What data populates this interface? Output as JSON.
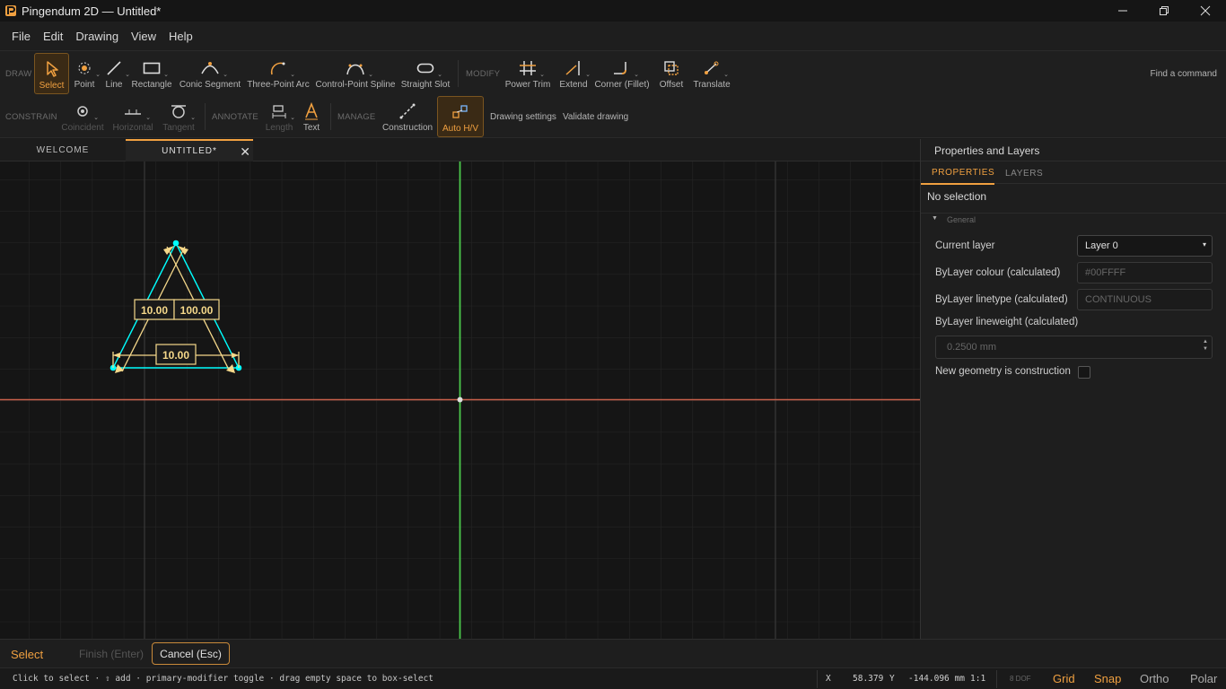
{
  "window": {
    "title": "Pingendum 2D — Untitled*",
    "controls": [
      "minimize-icon",
      "maximize-icon",
      "close-icon"
    ]
  },
  "menu": [
    "File",
    "Edit",
    "Drawing",
    "View",
    "Help"
  ],
  "toolbar": {
    "draw_label": "DRAW",
    "modify_label": "MODIFY",
    "draw_tools": {
      "select": "Select",
      "point": "Point",
      "line": "Line",
      "rectangle": "Rectangle",
      "conic": "Conic Segment",
      "arc": "Three-Point Arc",
      "spline": "Control-Point Spline",
      "slot": "Straight Slot"
    },
    "modify_tools": {
      "power_trim": "Power Trim",
      "extend": "Extend",
      "fillet": "Corner (Fillet)",
      "offset": "Offset",
      "translate": "Translate"
    },
    "find_command": "Find a command"
  },
  "toolbar2": {
    "constrain_label": "CONSTRAIN",
    "annotate_label": "ANNOTATE",
    "manage_label": "MANAGE",
    "coincident": "Coincident",
    "horizontal": "Horizontal",
    "tangent": "Tangent",
    "length": "Length",
    "text": "Text",
    "construction": "Construction",
    "auto_hv": "Auto H/V",
    "drawing_settings": "Drawing settings",
    "validate_drawing": "Validate drawing"
  },
  "tabs": {
    "welcome": "WELCOME",
    "untitled": "UNTITLED*"
  },
  "canvas": {
    "dim_left": "10.00",
    "dim_angle": "100.00",
    "dim_bottom": "10.00",
    "geometry_color": "#00FFFF",
    "constraint_color": "#F5D88A"
  },
  "panel": {
    "title": "Properties and Layers",
    "tab_properties": "PROPERTIES",
    "tab_layers": "LAYERS",
    "no_selection": "No selection",
    "section_general": "General",
    "current_layer_label": "Current layer",
    "current_layer_value": "Layer 0",
    "bylayer_colour_label": "ByLayer colour (calculated)",
    "bylayer_colour_value": "#00FFFF",
    "bylayer_linetype_label": "ByLayer linetype (calculated)",
    "bylayer_linetype_value": "CONTINUOUS",
    "bylayer_lineweight_label": "ByLayer lineweight (calculated)",
    "bylayer_lineweight_value": "0.2500 mm",
    "construction_label": "New geometry is construction",
    "construction_checked": false
  },
  "command_bar": {
    "mode": "Select",
    "finish": "Finish (Enter)",
    "cancel": "Cancel (Esc)"
  },
  "status": {
    "hint": "Click to select · ⇧ add · primary-modifier toggle · drag empty space to box-select",
    "x_label": "X",
    "x_value": "58.379",
    "y_label": "Y",
    "y_value": "-144.096 mm",
    "scale": "1:1",
    "dof": "8 DOF",
    "grid": "Grid",
    "snap": "Snap",
    "ortho": "Ortho",
    "polar": "Polar"
  }
}
